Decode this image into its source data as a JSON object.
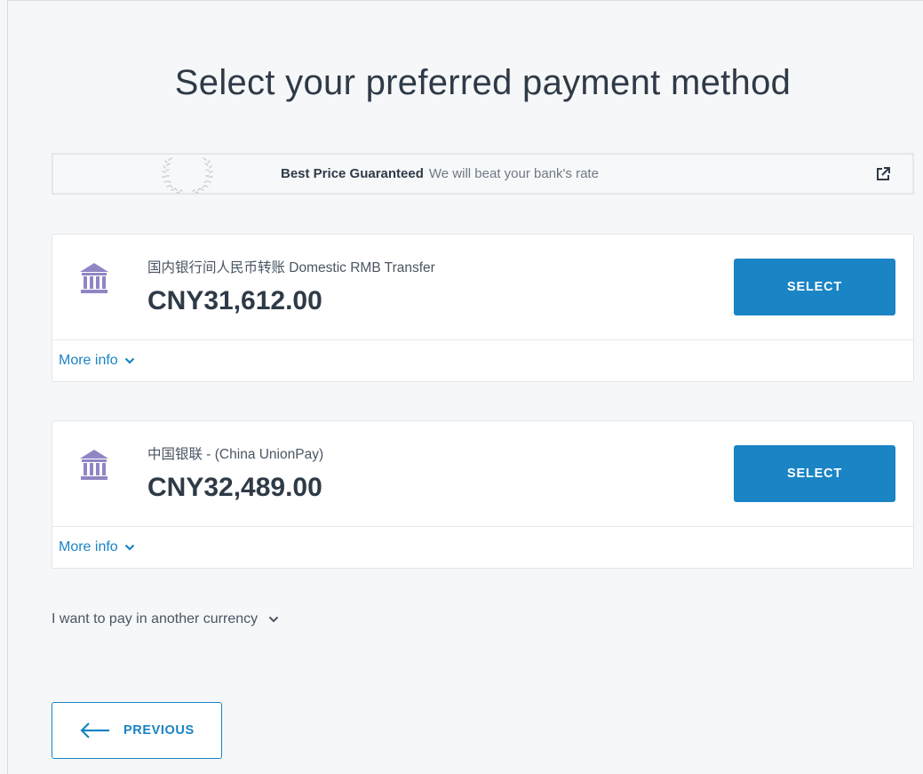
{
  "page": {
    "title": "Select your preferred payment method"
  },
  "banner": {
    "strong": "Best Price Guaranteed",
    "sub": "We will beat your bank's rate",
    "badge_icon": "laurel-wreath-icon",
    "link_icon": "external-link-icon"
  },
  "methods": [
    {
      "name": "国内银行间人民币转账 Domestic RMB Transfer",
      "amount": "CNY31,612.00",
      "select_label": "SELECT",
      "more_info_label": "More info",
      "icon": "bank-icon"
    },
    {
      "name": "中国银联 - (China UnionPay)",
      "amount": "CNY32,489.00",
      "select_label": "SELECT",
      "more_info_label": "More info",
      "icon": "bank-icon"
    }
  ],
  "other_currency": {
    "label": "I want to pay in another currency"
  },
  "navigation": {
    "previous_label": "PREVIOUS"
  },
  "colors": {
    "accent": "#1a84c5",
    "bank_icon": "#8f86c4",
    "text_dark": "#2f3a47"
  }
}
